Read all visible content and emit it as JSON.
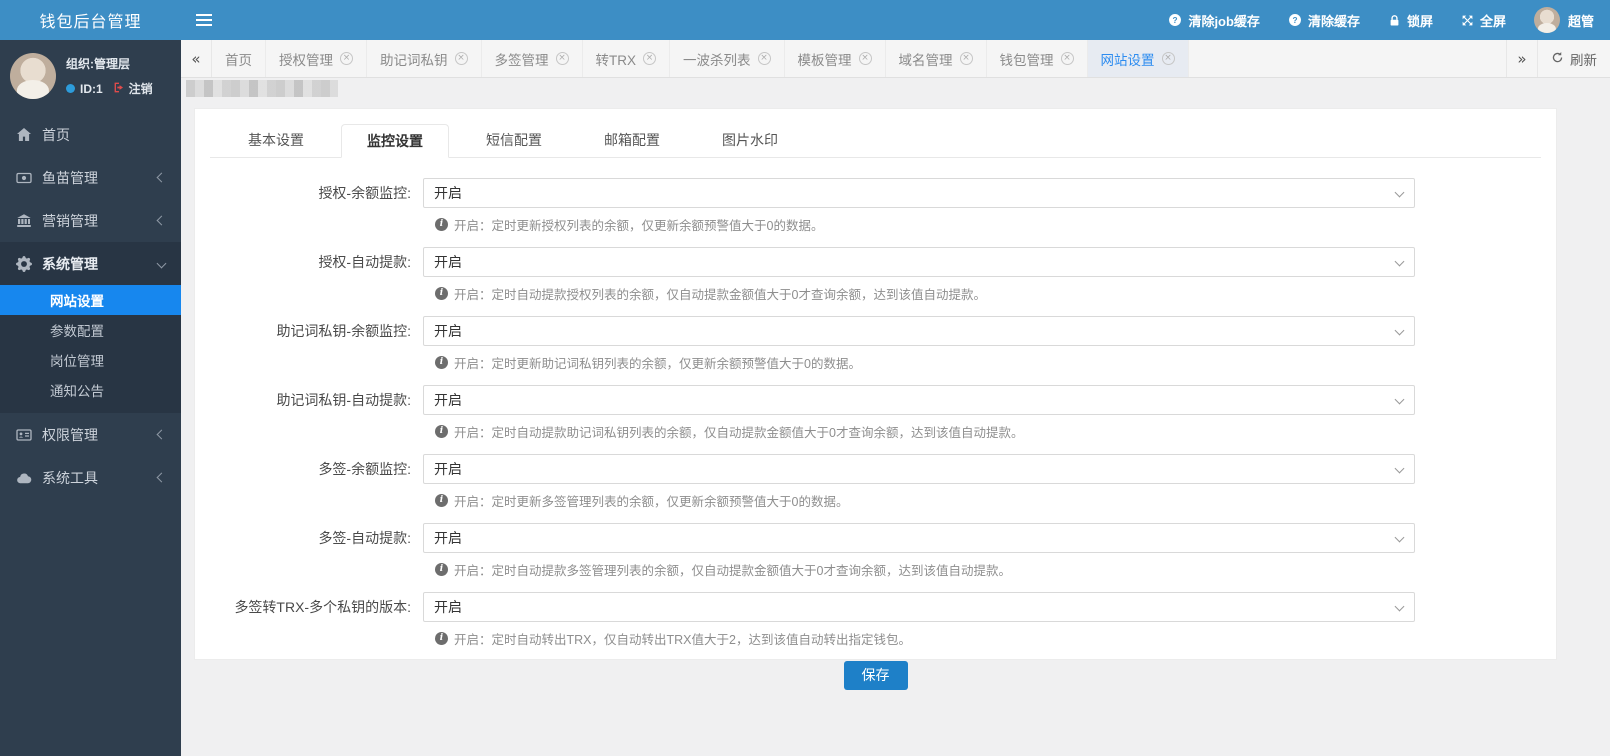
{
  "app": {
    "title": "钱包后台管理"
  },
  "colors": {
    "header_blue": "#3d8ec5",
    "sidebar_dark": "#2f3e4e",
    "accent_blue": "#1787ee",
    "active_tab_text": "#2d8cf0",
    "save_button_blue": "#1e80c8",
    "logout_red": "#e04b4b"
  },
  "icons": {
    "prev": "«",
    "next": "»",
    "close": "×"
  },
  "topbar": {
    "items": [
      {
        "label": "清除job缓存",
        "icon": "question-circle-icon"
      },
      {
        "label": "清除缓存",
        "icon": "question-circle-icon"
      },
      {
        "label": "锁屏",
        "icon": "lock-icon"
      },
      {
        "label": "全屏",
        "icon": "fullscreen-icon"
      }
    ],
    "user": {
      "name": "超管"
    }
  },
  "tabbar": {
    "tabs": [
      {
        "label": "首页",
        "closable": false,
        "active": false
      },
      {
        "label": "授权管理",
        "closable": true,
        "active": false
      },
      {
        "label": "助记词私钥",
        "closable": true,
        "active": false
      },
      {
        "label": "多签管理",
        "closable": true,
        "active": false
      },
      {
        "label": "转TRX",
        "closable": true,
        "active": false
      },
      {
        "label": "一波杀列表",
        "closable": true,
        "active": false
      },
      {
        "label": "模板管理",
        "closable": true,
        "active": false
      },
      {
        "label": "域名管理",
        "closable": true,
        "active": false
      },
      {
        "label": "钱包管理",
        "closable": true,
        "active": false
      },
      {
        "label": "网站设置",
        "closable": true,
        "active": true
      }
    ],
    "refresh_label": "刷新"
  },
  "sidebar": {
    "user": {
      "org": "组织:管理层",
      "id": "ID:1",
      "logout": "注销"
    },
    "menu": [
      {
        "label": "首页",
        "icon": "home-icon"
      },
      {
        "label": "鱼苗管理",
        "icon": "banknote-icon",
        "chevron": "left"
      },
      {
        "label": "营销管理",
        "icon": "bank-icon",
        "chevron": "left"
      },
      {
        "label": "系统管理",
        "icon": "gear-icon",
        "chevron": "down",
        "expanded": true,
        "children": [
          {
            "label": "网站设置",
            "active": true
          },
          {
            "label": "参数配置",
            "active": false
          },
          {
            "label": "岗位管理",
            "active": false
          },
          {
            "label": "通知公告",
            "active": false
          }
        ]
      },
      {
        "label": "权限管理",
        "icon": "idcard-icon",
        "chevron": "left"
      },
      {
        "label": "系统工具",
        "icon": "cloud-icon",
        "chevron": "left"
      }
    ]
  },
  "content": {
    "tabs": [
      {
        "label": "基本设置",
        "active": false
      },
      {
        "label": "监控设置",
        "active": true
      },
      {
        "label": "短信配置",
        "active": false
      },
      {
        "label": "邮箱配置",
        "active": false
      },
      {
        "label": "图片水印",
        "active": false
      }
    ],
    "form": {
      "rows": [
        {
          "label": "授权-余额监控:",
          "value": "开启",
          "hint": "开启：定时更新授权列表的余额，仅更新余额预警值大于0的数据。"
        },
        {
          "label": "授权-自动提款:",
          "value": "开启",
          "hint": "开启：定时自动提款授权列表的余额，仅自动提款金额值大于0才查询余额，达到该值自动提款。"
        },
        {
          "label": "助记词私钥-余额监控:",
          "value": "开启",
          "hint": "开启：定时更新助记词私钥列表的余额，仅更新余额预警值大于0的数据。"
        },
        {
          "label": "助记词私钥-自动提款:",
          "value": "开启",
          "hint": "开启：定时自动提款助记词私钥列表的余额，仅自动提款金额值大于0才查询余额，达到该值自动提款。"
        },
        {
          "label": "多签-余额监控:",
          "value": "开启",
          "hint": "开启：定时更新多签管理列表的余额，仅更新余额预警值大于0的数据。"
        },
        {
          "label": "多签-自动提款:",
          "value": "开启",
          "hint": "开启：定时自动提款多签管理列表的余额，仅自动提款金额值大于0才查询余额，达到该值自动提款。"
        },
        {
          "label": "多签转TRX-多个私钥的版本:",
          "value": "开启",
          "hint": "开启：定时自动转出TRX，仅自动转出TRX值大于2，达到该值自动转出指定钱包。"
        }
      ],
      "save_label": "保存"
    }
  }
}
